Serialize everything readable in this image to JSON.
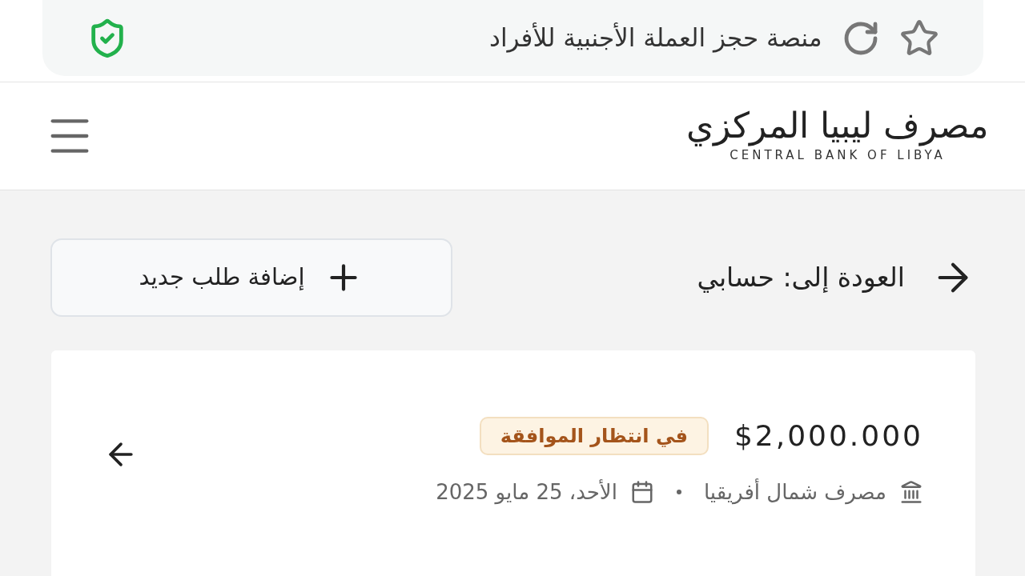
{
  "browser_bar": {
    "title": "منصة حجز العملة الأجنبية للأفراد"
  },
  "header": {
    "logo_arabic": "مصرف ليبيا المركزي",
    "logo_english": "CENTRAL BANK OF LIBYA"
  },
  "actions": {
    "back_link": "العودة إلى: حسابي",
    "add_button": "إضافة طلب جديد"
  },
  "requests": [
    {
      "amount": "$2,000.000",
      "status": "في انتظار الموافقة",
      "bank": "مصرف شمال أفريقيا",
      "date": "الأحد، 25 مايو 2025"
    }
  ]
}
